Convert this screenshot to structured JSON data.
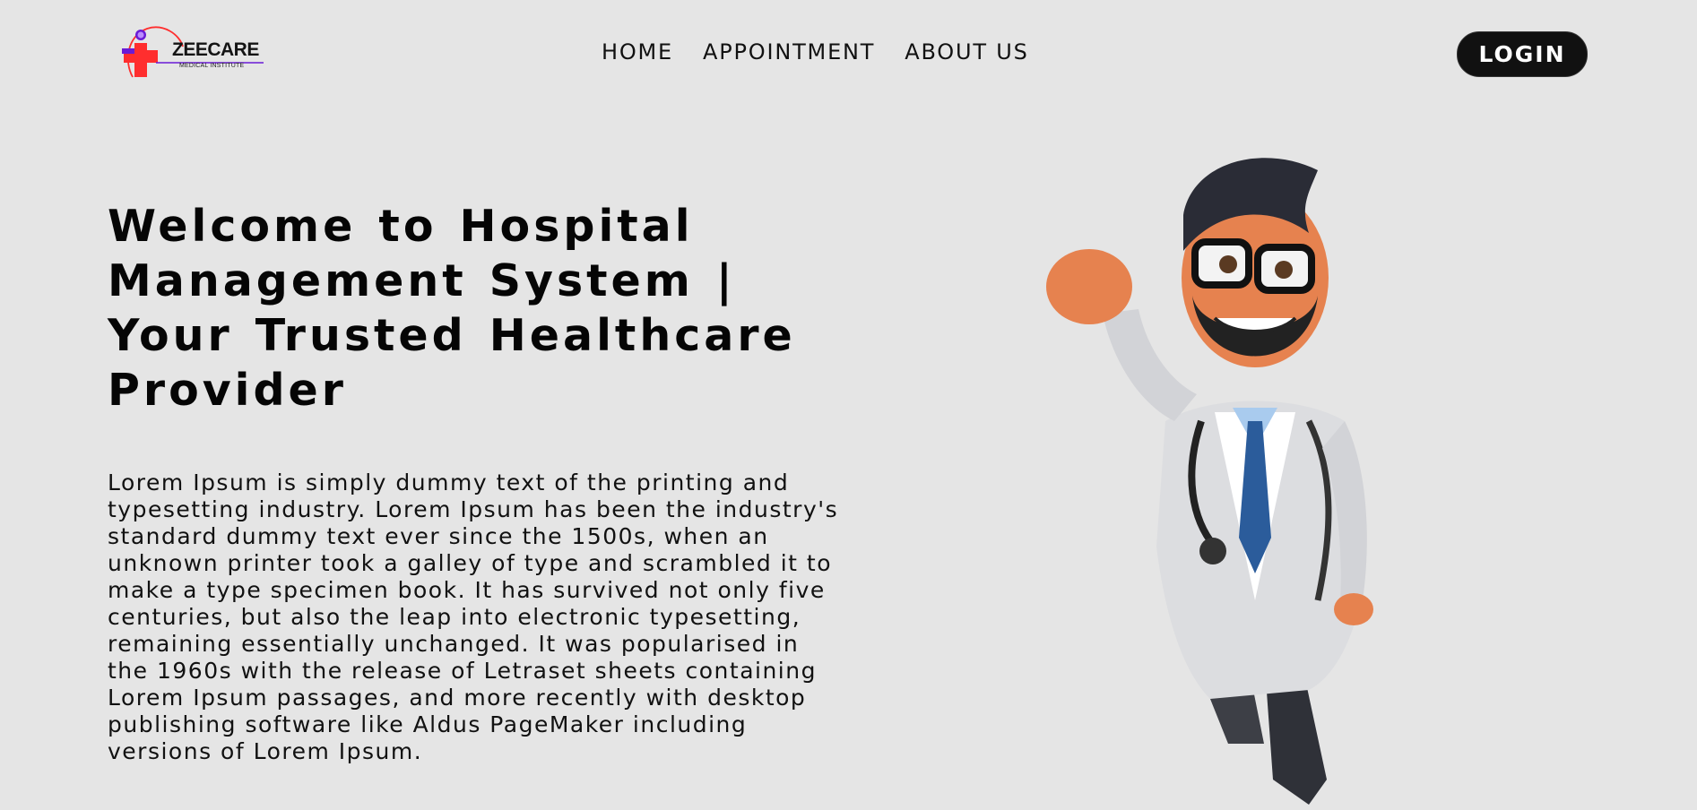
{
  "brand": {
    "name": "ZEECARE",
    "tagline": "MEDICAL INSTITUTE",
    "colors": {
      "cross": "#ff2e2e",
      "accent": "#6a1bd6"
    }
  },
  "nav": {
    "items": [
      {
        "label": "HOME"
      },
      {
        "label": "APPOINTMENT"
      },
      {
        "label": "ABOUT US"
      }
    ],
    "login_label": "LOGIN"
  },
  "hero": {
    "title": "Welcome to Hospital Management System | Your Trusted Healthcare Provider",
    "description": "Lorem Ipsum is simply dummy text of the printing and typesetting industry. Lorem Ipsum has been the industry's standard dummy text ever since the 1500s, when an unknown printer took a galley of type and scrambled it to make a type specimen book. It has survived not only five centuries, but also the leap into electronic typesetting, remaining essentially unchanged. It was popularised in the 1960s with the release of Letraset sheets containing Lorem Ipsum passages, and more recently with desktop publishing software like Aldus PageMaker including versions of Lorem Ipsum.",
    "image_icon": "cartoon-doctor-illustration"
  },
  "colors": {
    "background": "#e5e5e5",
    "text": "#111111",
    "button_bg": "#111111",
    "button_text": "#ffffff"
  }
}
